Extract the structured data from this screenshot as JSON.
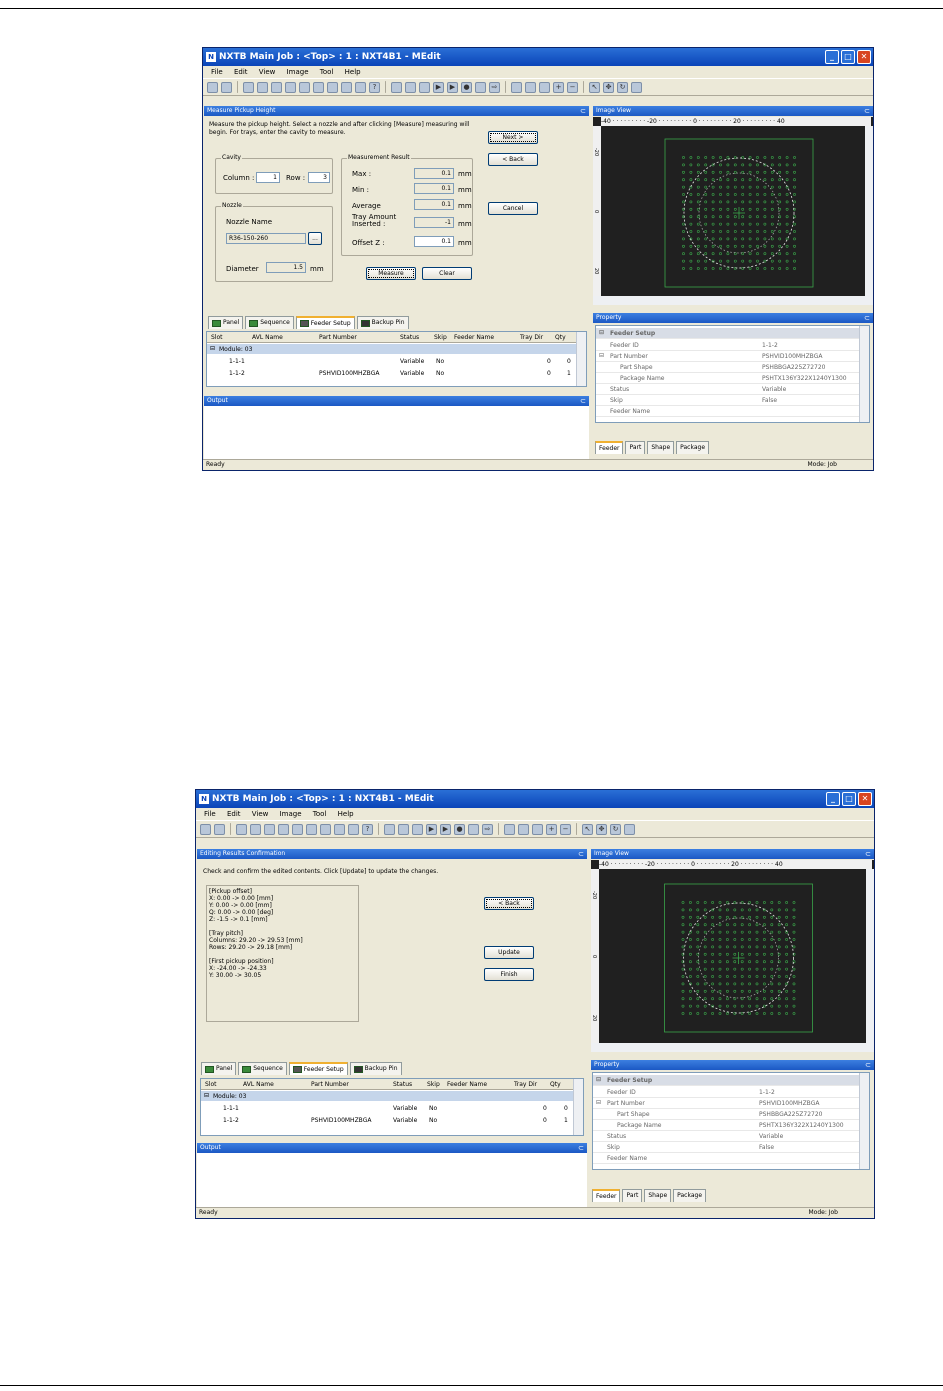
{
  "window_title": "NXTB Main Job : <Top> : 1 : NXT4B1 - MEdit",
  "app_icon": "N",
  "menu": [
    "File",
    "Edit",
    "View",
    "Image",
    "Tool",
    "Help"
  ],
  "screens": [
    {
      "left_pane_title": "Measure Pickup Height",
      "instructions": "Measure the pickup height. Select a nozzle and after clicking [Measure] measuring will begin.  For trays, enter the cavity to measure.",
      "cavity": {
        "group_label": "Cavity",
        "column_label": "Column :",
        "column_value": "1",
        "row_label": "Row :",
        "row_value": "3"
      },
      "nozzle": {
        "group_label": "Nozzle",
        "name_label": "Nozzle Name",
        "name_value": "R36-150-260",
        "browse_label": "...",
        "diameter_label": "Diameter",
        "diameter_value": "1.5",
        "diameter_unit": "mm"
      },
      "measurement": {
        "group_label": "Measurement Result",
        "rows": [
          {
            "label": "Max :",
            "value": "0.1",
            "unit": "mm"
          },
          {
            "label": "Min :",
            "value": "0.1",
            "unit": "mm"
          },
          {
            "label": "Average",
            "value": "0.1",
            "unit": "mm"
          },
          {
            "label": "Tray Amount Inserted :",
            "value": "-1",
            "unit": "mm"
          },
          {
            "label": "Offset Z :",
            "value": "0.1",
            "unit": "mm"
          }
        ]
      },
      "buttons": {
        "next": "Next >",
        "back": "< Back",
        "cancel": "Cancel",
        "measure": "Measure",
        "clear": "Clear"
      }
    },
    {
      "left_pane_title": "Editing Results Confirmation",
      "instructions": "Check and confirm the edited contents. Click [Update] to update the changes.",
      "results_text": "[Pickup offset]\nX: 0.00 -> 0.00 [mm]\nY: 0.00 -> 0.00 [mm]\nQ: 0.00 -> 0.00 [deg]\nZ: -1.5 -> 0.1 [mm]\n\n[Tray pitch]\nColumns: 29.20 -> 29.53 [mm]\nRows: 29.20 -> 29.18 [mm]\n\n[First pickup position]\nX: -24.00 -> -24.33\nY: 30.00 -> 30.05",
      "buttons": {
        "back": "< Back",
        "update": "Update",
        "finish": "Finish"
      }
    }
  ],
  "image_view": {
    "title": "Image View",
    "hruler": "-40 · · · · · · · · · -20 · · · · · · · · · 0 · · · · · · · · · 20 · · · · · · · · · 40",
    "vruler": [
      "-20",
      "0",
      "20"
    ]
  },
  "bottom_tabs": [
    "Panel",
    "Sequence",
    "Feeder Setup",
    "Backup Pin"
  ],
  "grid": {
    "columns": [
      "Slot",
      "AVL Name",
      "Part Number",
      "Status",
      "Skip",
      "Feeder Name",
      "Tray Dir",
      "Qty"
    ],
    "group": "Module: 03",
    "rows": [
      {
        "slot": "1-1-1",
        "avl": "",
        "part": "",
        "status": "Variable",
        "skip": "No",
        "feeder": "",
        "traydir": "0",
        "qty": "0"
      },
      {
        "slot": "1-1-2",
        "avl": "",
        "part": "PSHVID100MHZBGA",
        "status": "Variable",
        "skip": "No",
        "feeder": "",
        "traydir": "0",
        "qty": "1"
      }
    ]
  },
  "output_title": "Output",
  "property": {
    "title": "Property",
    "category": "Feeder Setup",
    "rows": [
      {
        "key": "Feeder ID",
        "value": "1-1-2"
      },
      {
        "key": "Part Number",
        "value": "PSHVID100MHZBGA"
      },
      {
        "key": "Part Shape",
        "value": "PSHBBGA225Z72720"
      },
      {
        "key": "Package Name",
        "value": "PSHTX136Y322X1240Y1300"
      },
      {
        "key": "Status",
        "value": "Variable"
      },
      {
        "key": "Skip",
        "value": "False"
      },
      {
        "key": "Feeder Name",
        "value": ""
      }
    ],
    "tabs": [
      "Feeder",
      "Part",
      "Shape",
      "Package"
    ]
  },
  "status": {
    "left": "Ready",
    "mode": "Mode: Job"
  },
  "colors": {
    "titlebar": "#0a44b8",
    "pane_title": "#1b58c4",
    "image_bg": "#202020",
    "pad_dot": "#3aa64a"
  },
  "icons": [
    "minimize-icon",
    "maximize-icon",
    "close-icon",
    "pin-icon",
    "expand-icon",
    "collapse-icon"
  ]
}
